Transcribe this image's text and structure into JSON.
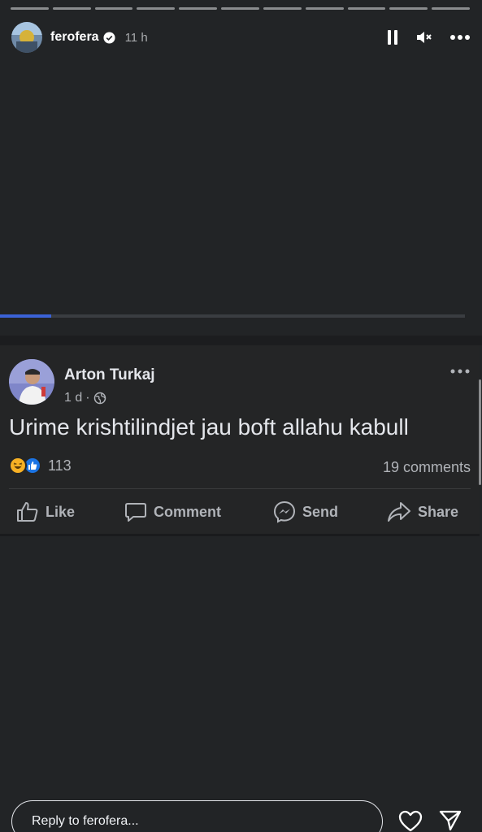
{
  "story": {
    "username": "ferofera",
    "time": "11 h",
    "segments": 11,
    "video_progress_percent": 11,
    "icons": {
      "avatar": "user-avatar",
      "verified": "verified-badge-icon",
      "pause": "pause-icon",
      "mute": "muted-speaker-icon",
      "more": "more-horizontal-icon"
    }
  },
  "post": {
    "author": "Arton Turkaj",
    "time": "1 d",
    "separator": "·",
    "text": "Urime krishtilindjet jau boft allahu kabull",
    "reaction_count": "113",
    "comments": "19 comments",
    "actions": {
      "like": "Like",
      "comment": "Comment",
      "send": "Send",
      "share": "Share"
    },
    "icons": {
      "privacy": "globe-icon",
      "more": "more-horizontal-icon",
      "haha": "haha-reaction-icon",
      "like_reaction": "like-reaction-icon"
    },
    "colors": {
      "like_blue": "#1b74e4",
      "haha_yellow": "#f7b125"
    }
  },
  "reply": {
    "placeholder": "Reply to ferofera...",
    "icons": {
      "heart": "heart-icon",
      "send": "paper-plane-icon"
    }
  }
}
